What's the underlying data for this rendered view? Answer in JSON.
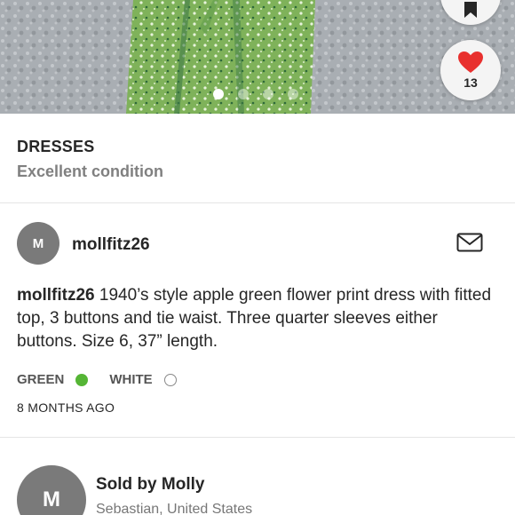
{
  "hero": {
    "carousel_total": 4,
    "carousel_active": 0,
    "like_count": "13"
  },
  "listing": {
    "category": "DRESSES",
    "condition": "Excellent condition"
  },
  "author": {
    "avatar_initial": "M",
    "username": "mollfitz26"
  },
  "description": {
    "author": "mollfitz26",
    "text": "1940’s style apple green flower print dress with fitted top, 3 buttons and tie waist. Three quarter sleeves either buttons. Size 6, 37” length."
  },
  "colors": [
    {
      "label": "GREEN",
      "swatch": "#55b535"
    },
    {
      "label": "WHITE",
      "swatch": "#ffffff"
    }
  ],
  "posted": "8 MONTHS AGO",
  "seller": {
    "avatar_initial": "M",
    "name": "Sold by Molly",
    "location": "Sebastian, United States"
  },
  "icons": [
    "bookmark-icon",
    "heart-icon",
    "mail-icon"
  ],
  "accent_colors": {
    "heart": "#e8302e",
    "green": "#55b535"
  }
}
